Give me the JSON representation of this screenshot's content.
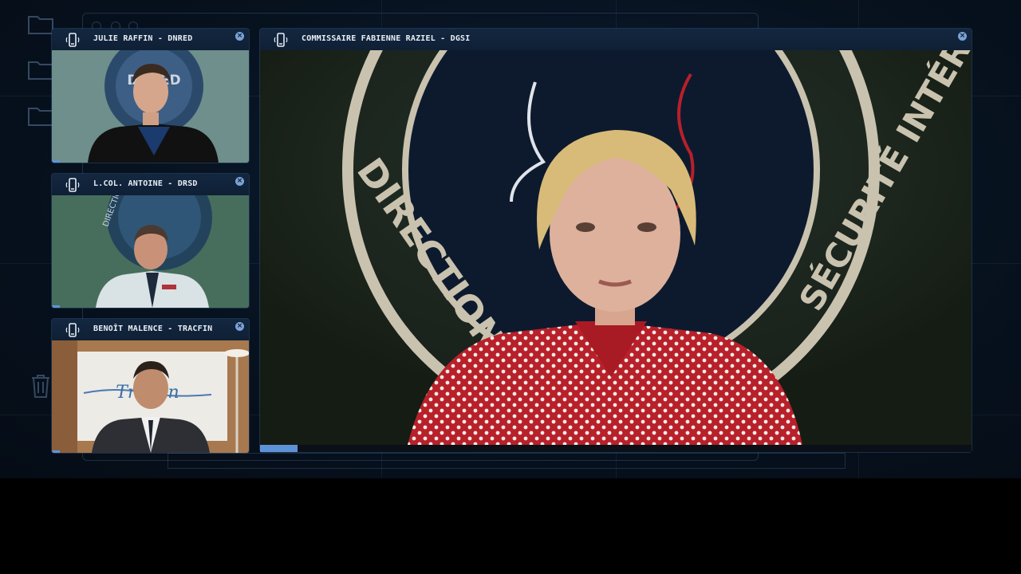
{
  "calls": [
    {
      "name": "JULIE RAFFIN - DNRED",
      "seal_text": "DNRED"
    },
    {
      "name": "L.COL. ANTOINE - DRSD",
      "seal_text": "DIRECTION"
    },
    {
      "name": "BENOÎT MALENCE - TRACFIN",
      "seal_text": "Tracfin"
    }
  ],
  "main_call": {
    "name": "COMMISSAIRE FABIENNE RAZIEL - DGSI",
    "seal_left": "DIRECTION GÉNÉR",
    "seal_right": "SÉCURITÉ INTÉRIEURE",
    "playback_progress": 0.053
  },
  "colors": {
    "accent": "#5d93d6",
    "header_bg": "#132740",
    "desktop_bg": "#07121f"
  },
  "icons": {
    "call": "phone-icon",
    "close": "close-icon",
    "desktop": [
      "folder-icon",
      "folder-icon",
      "folder-icon",
      "trash-icon"
    ]
  },
  "close_glyph": "×"
}
